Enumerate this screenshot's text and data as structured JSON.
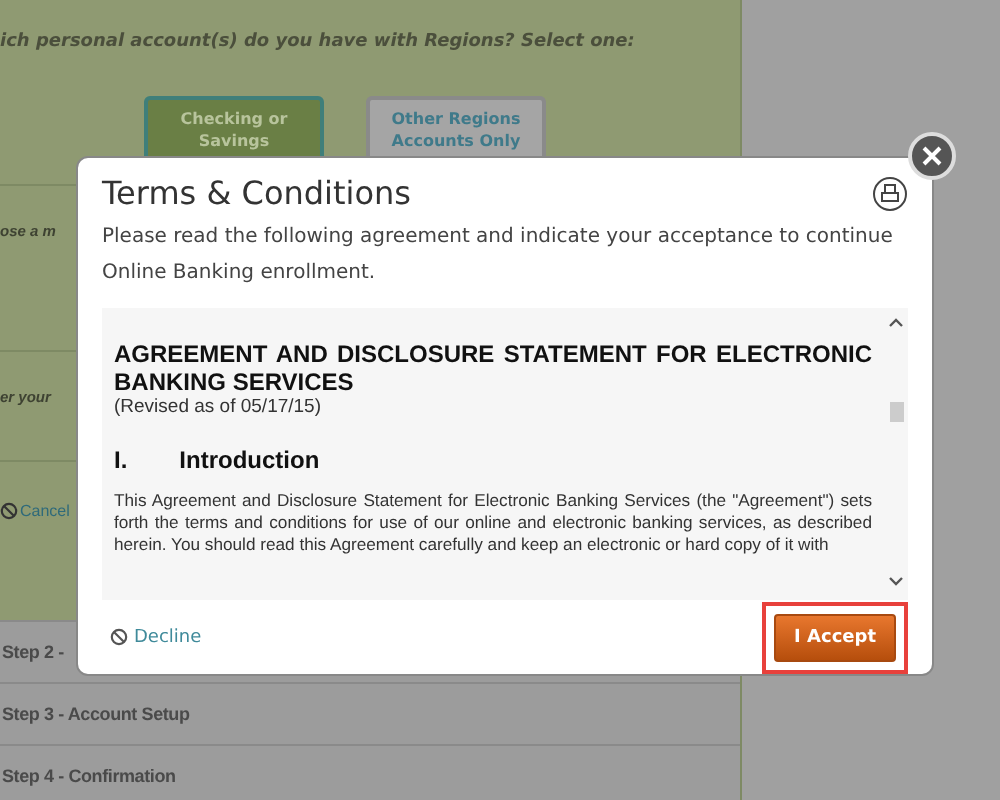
{
  "background": {
    "question": "ich personal account(s) do you have with Regions? Select one:",
    "choices": [
      {
        "label": "Checking or Savings",
        "selected": true
      },
      {
        "label": "Other Regions Accounts Only",
        "selected": false
      }
    ],
    "partial_labels": [
      "ose a m",
      "er your"
    ],
    "cancel": "Cancel",
    "steps": [
      "Step 2 -",
      "Step 3 - Account Setup",
      "Step 4 - Confirmation"
    ]
  },
  "dialog": {
    "title": "Terms & Conditions",
    "intro": "Please read the following agreement and indicate your acceptance to continue Online Banking enrollment.",
    "document": {
      "heading": "AGREEMENT AND DISCLOSURE STATEMENT FOR ELECTRONIC BANKING SERVICES",
      "revised": "(Revised as of 05/17/15)",
      "section_number": "I.",
      "section_title": "Introduction",
      "body": "This Agreement and Disclosure Statement for Electronic Banking Services (the \"Agreement\") sets forth the terms and conditions for use of our online and electronic banking services, as described herein. You should read this Agreement carefully and keep an electronic or hard copy of it with"
    },
    "decline": "Decline",
    "accept": {
      "label": "I Accept",
      "highlighted": true
    }
  }
}
